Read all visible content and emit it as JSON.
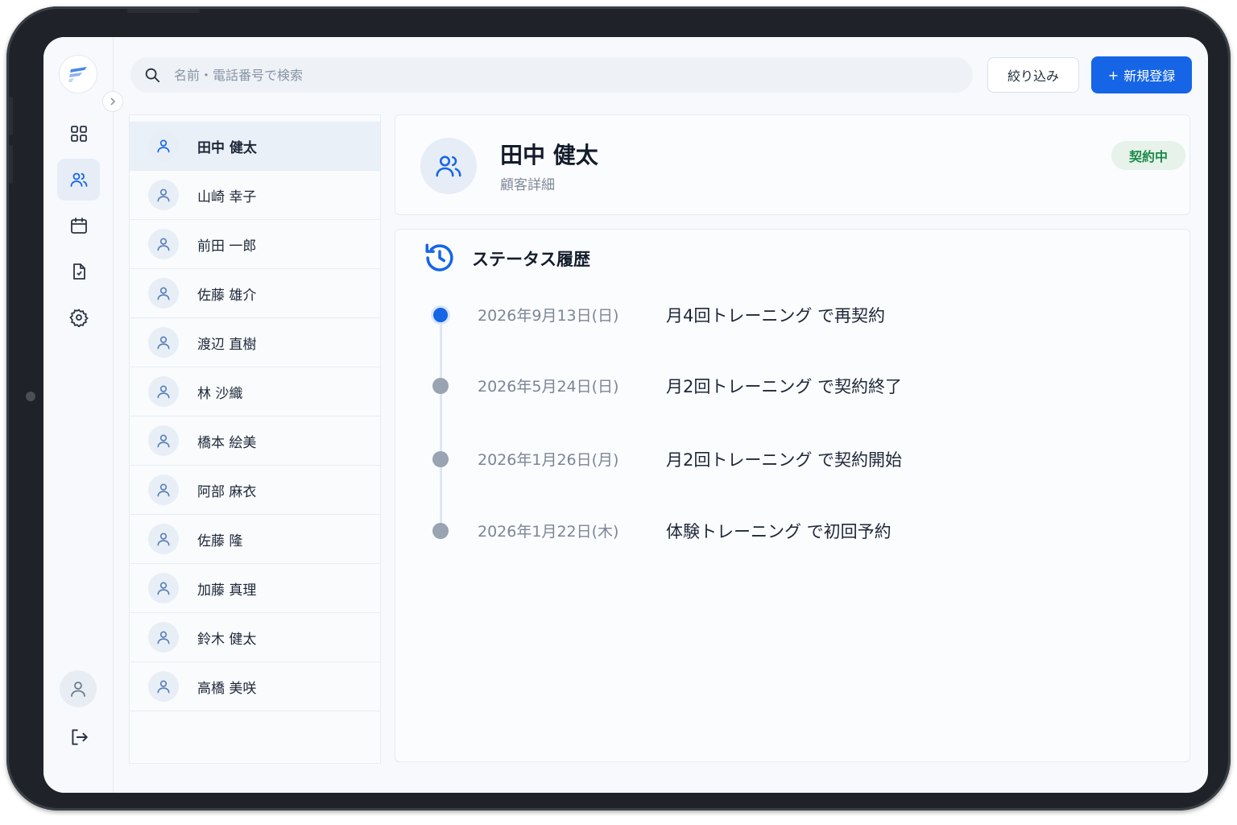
{
  "search": {
    "placeholder": "名前・電話番号で検索"
  },
  "toolbar": {
    "filter_label": "絞り込み",
    "new_label": "新規登録",
    "new_prefix": "+"
  },
  "customers": [
    "田中 健太",
    "山崎 幸子",
    "前田 一郎",
    "佐藤 雄介",
    "渡辺 直樹",
    "林 沙織",
    "橋本 絵美",
    "阿部 麻衣",
    "佐藤 隆",
    "加藤 真理",
    "鈴木 健太",
    "高橋 美咲"
  ],
  "detail": {
    "name": "田中 健太",
    "subtitle": "顧客詳細",
    "status": "契約中"
  },
  "history": {
    "title": "ステータス履歴",
    "entries": [
      {
        "date": "2026年9月13日(日)",
        "text": "月4回トレーニング で再契約"
      },
      {
        "date": "2026年5月24日(日)",
        "text": "月2回トレーニング で契約終了"
      },
      {
        "date": "2026年1月26日(月)",
        "text": "月2回トレーニング で契約開始"
      },
      {
        "date": "2026年1月22日(木)",
        "text": "体験トレーニング で初回予約"
      }
    ]
  },
  "colors": {
    "accent": "#1565e6",
    "status_green": "#1e8a4a",
    "status_bg": "#e6f2ea"
  },
  "icons": {
    "nav": [
      "grid-icon",
      "users-icon",
      "calendar-icon",
      "document-icon",
      "gear-icon"
    ],
    "footer": [
      "user-icon",
      "logout-icon"
    ]
  }
}
